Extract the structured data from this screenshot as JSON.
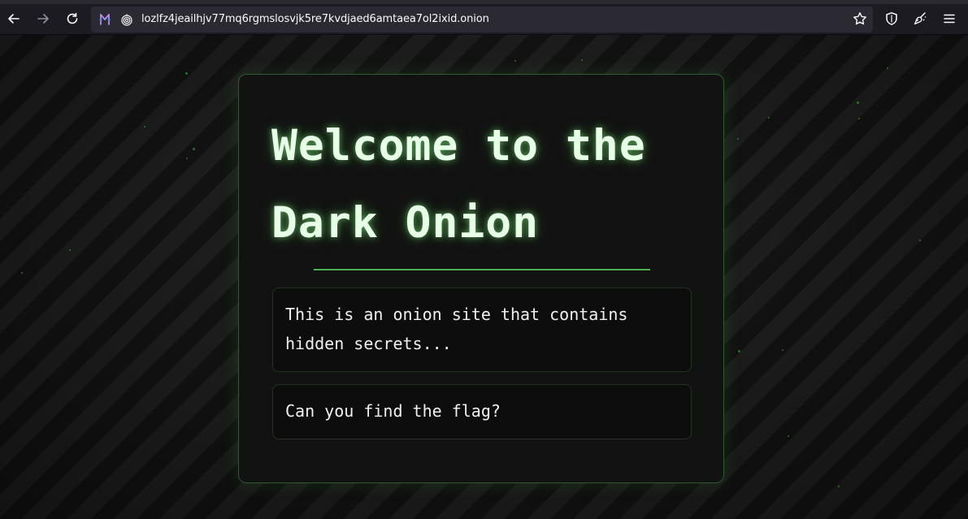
{
  "browser": {
    "url": "lozlfz4jeailhjv77mq6rgmslosvjk5re7kvdjaed6amtaea7ol2ixid.onion",
    "icons": {
      "back": "back-arrow-icon",
      "forward": "forward-arrow-icon",
      "reload": "reload-icon",
      "tor_circuit": "tor-circuit-icon",
      "onion": "onion-fingerprint-icon",
      "bookmark": "star-icon",
      "shield": "shield-icon",
      "new_identity": "broom-icon",
      "menu": "hamburger-menu-icon"
    }
  },
  "page": {
    "heading": "Welcome to the Dark Onion",
    "intro": "This is an onion site that contains hidden secrets...",
    "prompt": "Can you find the flag?"
  },
  "colors": {
    "accent_green": "#4caf50",
    "heading_text": "#e8ffe8",
    "browser_chrome": "#1c1b22",
    "urlbar_bg": "#2b2a33"
  }
}
